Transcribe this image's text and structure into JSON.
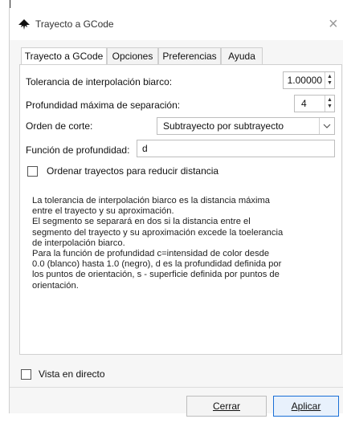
{
  "window": {
    "title": "Trayecto a GCode",
    "close_glyph": "×"
  },
  "tabs": [
    {
      "label": "Trayecto a GCode"
    },
    {
      "label": "Opciones"
    },
    {
      "label": "Preferencias"
    },
    {
      "label": "Ayuda"
    }
  ],
  "form": {
    "tolerance_label": "Tolerancia de interpolación biarco:",
    "tolerance_value": "1.00000",
    "depth_label": "Profundidad máxima de separación:",
    "depth_value": "4",
    "order_label": "Orden de corte:",
    "order_value": "Subtrayecto por subtrayecto",
    "function_label": "Función de profundidad:",
    "function_value": "d",
    "sort_label": "Ordenar trayectos para reducir distancia"
  },
  "description": [
    "La tolerancia de interpolación biarco es la distancia máxima",
    "entre el trayecto y su aproximación.",
    "El segmento se separará en dos si la distancia entre el",
    "segmento del trayecto y su aproximación excede la toelerancia",
    "de interpolación biarco.",
    "Para la función de profundidad c=intensidad de color desde",
    "0.0 (blanco) hasta 1.0 (negro), d es la profundidad definida por",
    "los puntos de orientación, s - superficie definida por puntos de",
    "orientación."
  ],
  "footer": {
    "live_preview_label": "Vista en directo",
    "close_button": "Cerrar",
    "apply_button": "Aplicar"
  },
  "colors": {
    "accent": "#1a6fd6",
    "window_bg": "#f6f6f6"
  },
  "icons": {
    "app": "inkscape-logo-icon",
    "spin": "spin-arrows-icon",
    "dropdown": "chevron-down-icon"
  }
}
